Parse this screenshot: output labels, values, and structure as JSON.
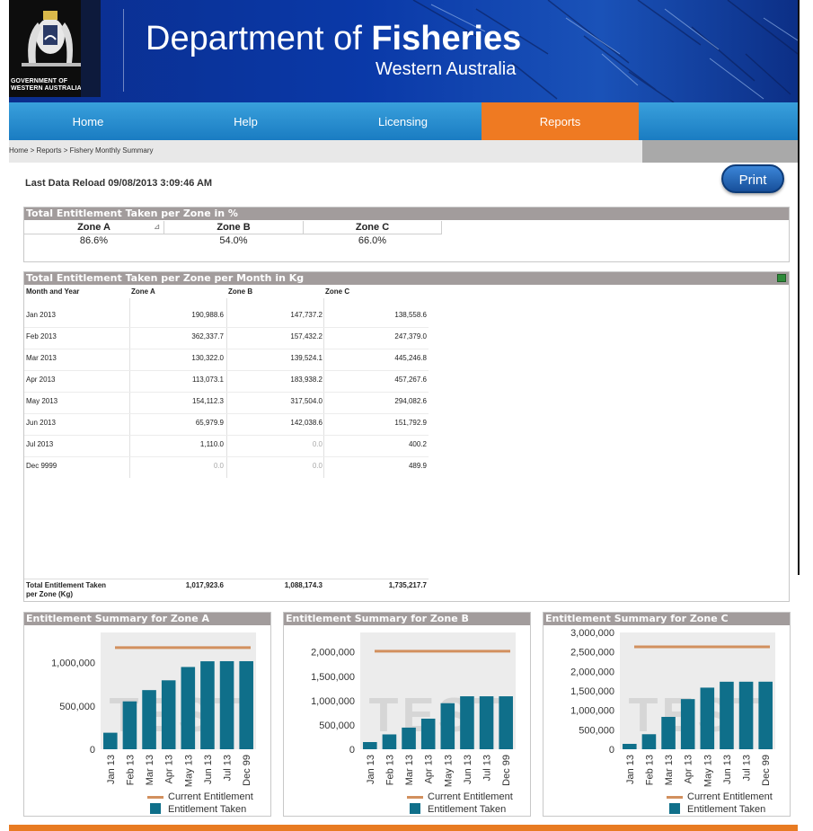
{
  "header": {
    "logo_text_line1": "GOVERNMENT OF",
    "logo_text_line2": "WESTERN AUSTRALIA",
    "title_prefix": "Department of ",
    "title_bold": "Fisheries",
    "subtitle": "Western Australia"
  },
  "nav": {
    "items": [
      {
        "label": "Home"
      },
      {
        "label": "Help"
      },
      {
        "label": "Licensing"
      },
      {
        "label": "Reports"
      }
    ],
    "active": "Reports"
  },
  "breadcrumb": {
    "home": "Home",
    "sep": " > ",
    "reports": "Reports",
    "current": "Fishery Monthly Summary"
  },
  "reload": "Last Data Reload 09/08/2013 3:09:46 AM",
  "print_label": "Print",
  "zone_percent": {
    "title": "Total Entitlement Taken per Zone in %",
    "headers": [
      "Zone A",
      "Zone B",
      "Zone C"
    ],
    "values": [
      "86.6%",
      "54.0%",
      "66.0%"
    ]
  },
  "monthly": {
    "title": "Total Entitlement Taken per Zone per Month in Kg",
    "headers": [
      "Month and Year",
      "Zone A",
      "Zone B",
      "Zone C"
    ],
    "rows": [
      [
        "Jan 2013",
        "190,988.6",
        "147,737.2",
        "138,558.6"
      ],
      [
        "Feb 2013",
        "362,337.7",
        "157,432.2",
        "247,379.0"
      ],
      [
        "Mar 2013",
        "130,322.0",
        "139,524.1",
        "445,246.8"
      ],
      [
        "Apr 2013",
        "113,073.1",
        "183,938.2",
        "457,267.6"
      ],
      [
        "May 2013",
        "154,112.3",
        "317,504.0",
        "294,082.6"
      ],
      [
        "Jun 2013",
        "65,979.9",
        "142,038.6",
        "151,792.9"
      ],
      [
        "Jul 2013",
        "1,110.0",
        "0.0",
        "400.2"
      ],
      [
        "Dec 9999",
        "0.0",
        "0.0",
        "489.9"
      ]
    ],
    "total_label_line1": "Total Entitlement Taken",
    "total_label_line2": "per Zone (Kg)",
    "totals": [
      "1,017,923.6",
      "1,088,174.3",
      "1,735,217.7"
    ]
  },
  "colors": {
    "nav_active": "#ef7a22",
    "nav_bg": "#2a8fd0",
    "panel_header": "#a29c9c",
    "bar": "#0f6f8a",
    "entitlement_line": "#d2905e"
  },
  "legend": {
    "current": "Current Entitlement",
    "taken": "Entitlement Taken"
  },
  "watermark": "TEST",
  "chart_data": [
    {
      "type": "bar",
      "title": "Entitlement Summary for Zone A",
      "categories": [
        "Jan 13",
        "Feb 13",
        "Mar 13",
        "Apr 13",
        "May 13",
        "Jun 13",
        "Jul 13",
        "Dec 99"
      ],
      "series": [
        {
          "name": "Entitlement Taken",
          "values": [
            190988.6,
            553326.3,
            683648.3,
            796721.4,
            950833.7,
            1016813.6,
            1017923.6,
            1017923.6
          ]
        },
        {
          "name": "Current Entitlement",
          "values": [
            1175000,
            1175000,
            1175000,
            1175000,
            1175000,
            1175000,
            1175000,
            1175000
          ]
        }
      ],
      "yticks": [
        0,
        500000,
        1000000
      ],
      "ytick_labels": [
        "0",
        "500,000",
        "1,000,000"
      ],
      "ylim": [
        0,
        1350000
      ]
    },
    {
      "type": "bar",
      "title": "Entitlement Summary for Zone B",
      "categories": [
        "Jan 13",
        "Feb 13",
        "Mar 13",
        "Apr 13",
        "May 13",
        "Jun 13",
        "Jul 13",
        "Dec 99"
      ],
      "series": [
        {
          "name": "Entitlement Taken",
          "values": [
            147737.2,
            305169.4,
            444693.5,
            628631.7,
            946135.7,
            1088174.3,
            1088174.3,
            1088174.3
          ]
        },
        {
          "name": "Current Entitlement",
          "values": [
            2015000,
            2015000,
            2015000,
            2015000,
            2015000,
            2015000,
            2015000,
            2015000
          ]
        }
      ],
      "yticks": [
        0,
        500000,
        1000000,
        1500000,
        2000000
      ],
      "ytick_labels": [
        "0",
        "500,000",
        "1,000,000",
        "1,500,000",
        "2,000,000"
      ],
      "ylim": [
        0,
        2400000
      ]
    },
    {
      "type": "bar",
      "title": "Entitlement Summary for Zone C",
      "categories": [
        "Jan 13",
        "Feb 13",
        "Mar 13",
        "Apr 13",
        "May 13",
        "Jun 13",
        "Jul 13",
        "Dec 99"
      ],
      "series": [
        {
          "name": "Entitlement Taken",
          "values": [
            138558.6,
            385937.6,
            831184.4,
            1288452.0,
            1582534.6,
            1734327.5,
            1734727.7,
            1735217.6
          ]
        },
        {
          "name": "Current Entitlement",
          "values": [
            2630000,
            2630000,
            2630000,
            2630000,
            2630000,
            2630000,
            2630000,
            2630000
          ]
        }
      ],
      "yticks": [
        0,
        500000,
        1000000,
        1500000,
        2000000,
        2500000,
        3000000
      ],
      "ytick_labels": [
        "0",
        "500,000",
        "1,000,000",
        "1,500,000",
        "2,000,000",
        "2,500,000",
        "3,000,000"
      ],
      "ylim": [
        0,
        3000000
      ]
    }
  ]
}
